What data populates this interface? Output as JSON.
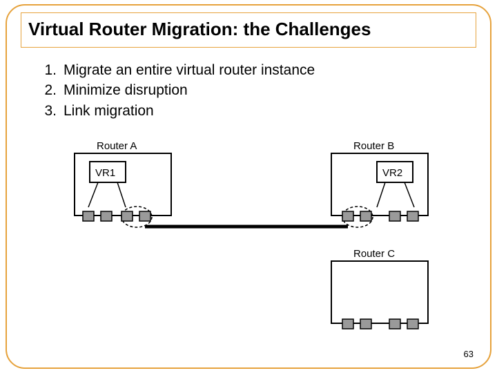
{
  "title": "Virtual Router Migration: the Challenges",
  "list": [
    {
      "num": "1.",
      "text": "Migrate an entire virtual router instance"
    },
    {
      "num": "2.",
      "text": "Minimize disruption"
    },
    {
      "num": "3.",
      "text": "Link migration"
    }
  ],
  "diagram": {
    "routerA_label": "Router A",
    "routerB_label": "Router B",
    "routerC_label": "Router C",
    "vr1_label": "VR1",
    "vr2_label": "VR2"
  },
  "page_number": "63"
}
